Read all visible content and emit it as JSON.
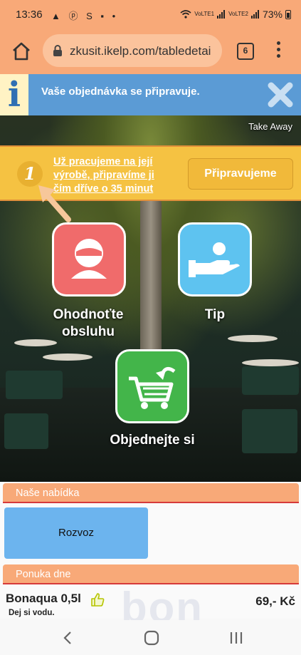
{
  "status_bar": {
    "time": "13:36",
    "notification_icons": "▲ ⓟ S ▪ •",
    "network_1": "VoLTE1",
    "network_2": "VoLTE2",
    "battery": "73%"
  },
  "browser": {
    "url": "zkusit.ikelp.com/tabledetai",
    "tab_count": "6"
  },
  "info_bar": {
    "icon": "i",
    "message": "Vaše objednávka se připravuje."
  },
  "take_away_label": "Take Away",
  "order_status": {
    "step_number": "1",
    "message": "Už pracujeme na její výrobě, připravíme ji čím dříve o 35 minut",
    "state_button": "Připravujeme"
  },
  "actions": {
    "rate_service": "Ohodnoťte obsluhu",
    "tip": "Tip",
    "order": "Objednejte si"
  },
  "sections": {
    "our_offer": "Naše nabídka",
    "delivery_button": "Rozvoz",
    "daily_menu": "Ponuka dne"
  },
  "product": {
    "name": "Bonaqua 0,5l",
    "description": "Dej si vodu.",
    "price": "69,- Kč",
    "background_text": "bon"
  },
  "colors": {
    "header_orange": "#f8a978",
    "info_blue": "#5b9bd5",
    "banner_yellow": "#f5c242",
    "rate_red": "#f06b6b",
    "tip_blue": "#5ec3f0",
    "order_green": "#43b54a",
    "delivery_blue": "#6cb4ee"
  }
}
